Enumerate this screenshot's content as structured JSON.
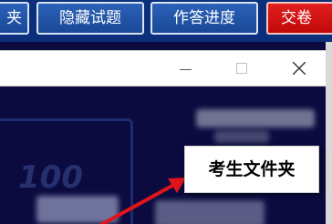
{
  "toolbar": {
    "partial_label": "夹",
    "hide_questions_label": "隐藏试题",
    "progress_label": "作答进度",
    "submit_label": "交卷"
  },
  "dialog": {
    "minimize_icon": "minimize-icon",
    "maximize_icon": "maximize-icon",
    "close_icon": "close-icon"
  },
  "content": {
    "faint_number": "100"
  },
  "callout": {
    "label": "考生文件夹"
  },
  "colors": {
    "toolbar_bg": "#0b2f7a",
    "button_blue": "#2c62b8",
    "submit_red": "#e21f1f",
    "content_bg": "#0b0b40",
    "arrow_red": "#e0151b"
  }
}
